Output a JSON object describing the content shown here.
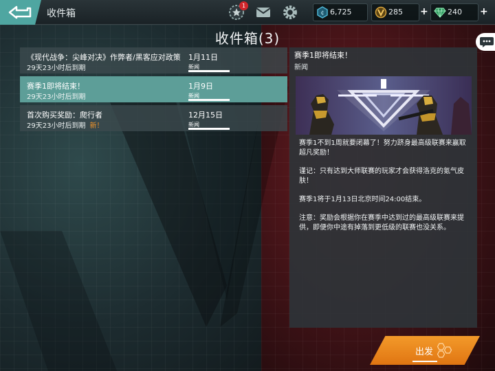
{
  "topbar": {
    "title": "收件箱",
    "notification_count": "1"
  },
  "currencies": [
    {
      "icon": "credits-icon",
      "value": "6,725"
    },
    {
      "icon": "gold-icon",
      "value": "285"
    },
    {
      "icon": "gem-icon",
      "value": "240"
    }
  ],
  "page_heading": "收件箱(3)",
  "messages": [
    {
      "title": "《现代战争：尖峰对决》作弊者/黑客应对政策",
      "expiry": "29天23小时后到期",
      "date": "1月11日",
      "category": "新闻",
      "new": ""
    },
    {
      "title": "赛季1即将结束！",
      "expiry": "29天23小时后到期",
      "date": "1月9日",
      "category": "新闻",
      "new": ""
    },
    {
      "title": "首次购买奖励：爬行者",
      "expiry": "29天23小时后到期",
      "date": "12月15日",
      "category": "新闻",
      "new": "新！"
    }
  ],
  "detail": {
    "title": "赛季1即将结束！",
    "category": "新闻",
    "paragraphs": [
      "赛季1不到1周就要闭幕了！努力跻身最高级联赛来赢取超凡奖励！",
      "谨记：只有达到大师联赛的玩家才会获得洛克的氪气皮肤！",
      "赛季1将于1月13日北京时间24:00结束。",
      "注意：奖励会根据你在赛季中达到过的最高级联赛来提供，即便你中途有掉落到更低级的联赛也没关系。"
    ]
  },
  "go_button": {
    "label": "出发"
  },
  "colors": {
    "accent_teal": "#5d9e98",
    "go_orange": "#f08a1f",
    "new_badge": "#f0932a",
    "notification_red": "#d0262b"
  }
}
